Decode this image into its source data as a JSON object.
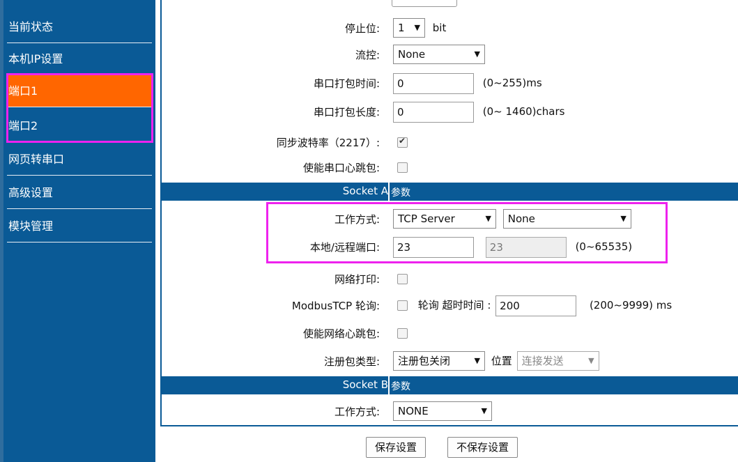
{
  "sidebar": {
    "items": [
      {
        "label": "当前状态"
      },
      {
        "label": "本机IP设置"
      },
      {
        "label": "端口1"
      },
      {
        "label": "端口2"
      },
      {
        "label": "网页转串口"
      },
      {
        "label": "高级设置"
      },
      {
        "label": "模块管理"
      }
    ],
    "active_index": 2
  },
  "serial": {
    "stop_bit": {
      "label": "停止位:",
      "value": "1",
      "unit": "bit"
    },
    "flow": {
      "label": "流控:",
      "value": "None"
    },
    "pack_time": {
      "label": "串口打包时间:",
      "value": "0",
      "hint": "(0~255)ms"
    },
    "pack_len": {
      "label": "串口打包长度:",
      "value": "0",
      "hint": "(0~ 1460)chars"
    },
    "sync_baud": {
      "label": "同步波特率（2217）:",
      "checked": true
    },
    "serial_heartbeat": {
      "label": "使能串口心跳包:",
      "checked": false
    }
  },
  "socket_a": {
    "header_name": "Socket A",
    "header_suffix": "参数",
    "work_mode": {
      "label": "工作方式:",
      "value": "TCP Server",
      "value2": "None"
    },
    "ports": {
      "label": "本地/远程端口:",
      "local": "23",
      "remote": "23",
      "hint": "(0~65535)"
    },
    "net_print": {
      "label": "网络打印:",
      "checked": false
    },
    "modbus": {
      "label": "ModbusTCP 轮询:",
      "checked": false,
      "text": "轮询 超时时间 :",
      "value": "200",
      "hint": "(200~9999) ms"
    },
    "net_heartbeat": {
      "label": "使能网络心跳包:",
      "checked": false
    },
    "register": {
      "label": "注册包类型:",
      "value": "注册包关闭",
      "position_label": "位置",
      "position_value": "连接发送"
    }
  },
  "socket_b": {
    "header_name": "Socket B",
    "header_suffix": "参数",
    "work_mode": {
      "label": "工作方式:",
      "value": "NONE"
    }
  },
  "buttons": {
    "save": "保存设置",
    "nosave": "不保存设置"
  },
  "colors": {
    "nav_bg": "#0a5a96",
    "active": "#ff6600",
    "highlight": "#ee22ee"
  }
}
